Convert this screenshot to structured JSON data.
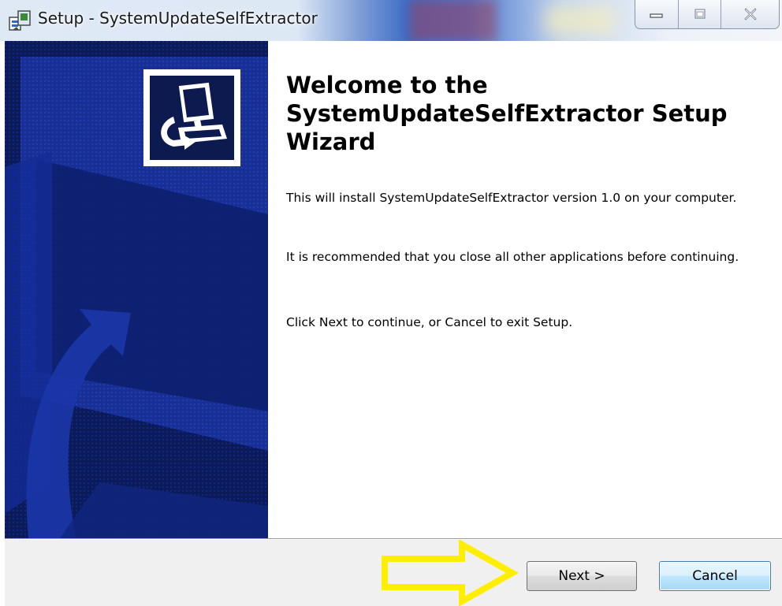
{
  "window": {
    "title": "Setup - SystemUpdateSelfExtractor",
    "controls": {
      "minimize_icon": "minimize-icon",
      "maximize_icon": "maximize-icon",
      "close_icon": "close-icon"
    }
  },
  "wizard": {
    "heading": "Welcome to the SystemUpdateSelfExtractor Setup Wizard",
    "paragraphs": [
      "This will install SystemUpdateSelfExtractor version 1.0 on your computer.",
      "It is recommended that you close all other applications before continuing.",
      "Click Next to continue, or Cancel to exit Setup."
    ],
    "logo_icon": "computer-install-icon"
  },
  "buttons": {
    "next_label": "Next >",
    "cancel_label": "Cancel"
  },
  "annotation": {
    "arrow_color": "#ffee00",
    "arrow_icon": "arrow-right-icon"
  },
  "colors": {
    "banner_bg": "#0a1a55",
    "title_accent": "#3e6cc6",
    "footer_bg": "#f0f0f0"
  }
}
